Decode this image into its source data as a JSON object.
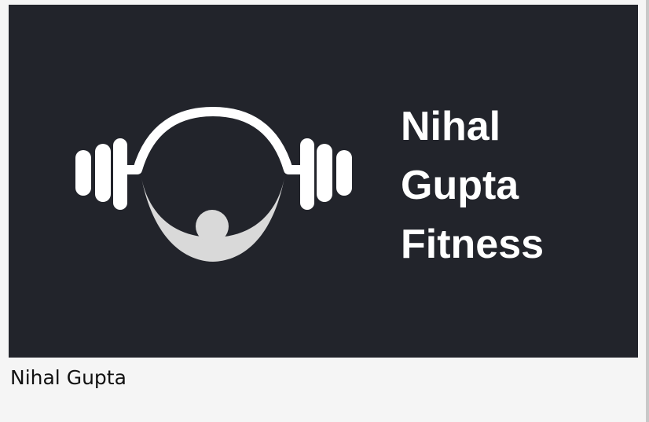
{
  "card": {
    "caption": "Nihal Gupta",
    "logo": {
      "text_lines": [
        "Nihal",
        "Gupta",
        "Fitness"
      ],
      "icon": "barbell-person-logo-icon",
      "colors": {
        "background": "#22242b",
        "foreground": "#ffffff",
        "figure": "#d9d9d9"
      }
    }
  }
}
